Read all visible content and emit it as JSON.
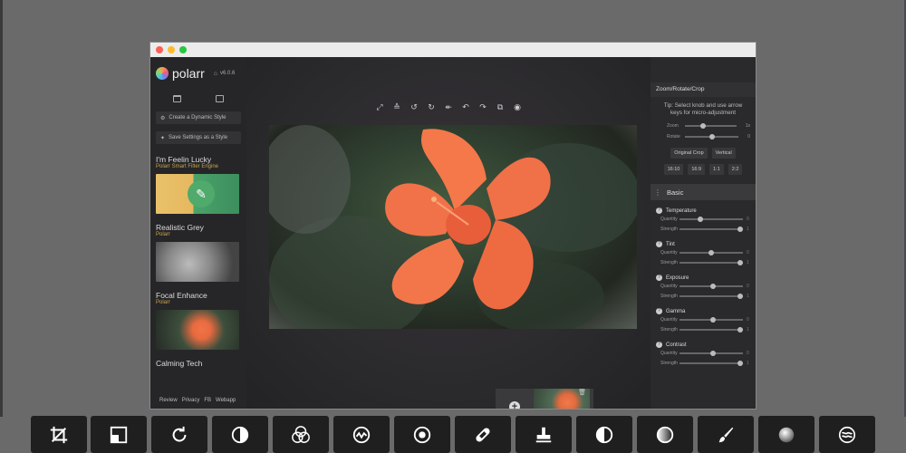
{
  "app": {
    "brand": "polarr",
    "version": "v6.0.6"
  },
  "left_panel": {
    "create_style": "Create a Dynamic Style",
    "save_settings": "Save Settings as a Style",
    "styles": [
      {
        "title": "I'm Feelin Lucky",
        "subtitle": "Polarr Smart Filter Engine"
      },
      {
        "title": "Realistic Grey",
        "subtitle": "Polarr"
      },
      {
        "title": "Focal Enhance",
        "subtitle": "Polarr"
      },
      {
        "title": "Calming Tech",
        "subtitle": ""
      }
    ],
    "footer": [
      "Review",
      "Privacy",
      "FB",
      "Webapp"
    ]
  },
  "filmstrip": {
    "count": "1"
  },
  "right_panel": {
    "section_title": "Zoom/Rotate/Crop",
    "tip": "Tip: Select knob and use arrow keys for micro-adjustment",
    "zoom_label": "Zoom",
    "rotate_label": "Rotate",
    "zoom_value": "1x",
    "rotate_value": "0",
    "original_crop": "Original Crop",
    "vertical": "Vertical",
    "ratios": [
      "16:10",
      "16:9",
      "1:1",
      "2:2"
    ],
    "basic_label": "Basic",
    "adjustments": [
      {
        "title": "Temperature",
        "quantity_label": "Quantity",
        "strength_label": "Strength",
        "quantity_value": "0",
        "strength_value": "1"
      },
      {
        "title": "Tint",
        "quantity_label": "Quantity",
        "strength_label": "Strength",
        "quantity_value": "0",
        "strength_value": "1"
      },
      {
        "title": "Exposure",
        "quantity_label": "Quantity",
        "strength_label": "Strength",
        "quantity_value": "0",
        "strength_value": "1"
      },
      {
        "title": "Gamma",
        "quantity_label": "Quantity",
        "strength_label": "Strength",
        "quantity_value": "0",
        "strength_value": "1"
      },
      {
        "title": "Contrast",
        "quantity_label": "Quantity",
        "strength_label": "Strength",
        "quantity_value": "0",
        "strength_value": "1"
      }
    ]
  },
  "toolbar_icons": [
    "fullscreen-icon",
    "compare-icon",
    "rotate-left-icon",
    "rotate-right-icon",
    "undo-all-icon",
    "undo-icon",
    "redo-icon",
    "copy-icon",
    "preview-icon"
  ],
  "dock_tools": [
    "crop-icon",
    "vignette-square-icon",
    "rotate-icon",
    "contrast-icon",
    "color-circles-icon",
    "curve-icon",
    "radial-icon",
    "bandage-icon",
    "stamp-icon",
    "tone-icon",
    "gradient-circle-icon",
    "brush-icon",
    "sphere-icon",
    "waves-icon"
  ],
  "colors": {
    "accent": "#c8a44e",
    "petal": "#f06a3f",
    "highlight": "#e0c23a"
  }
}
